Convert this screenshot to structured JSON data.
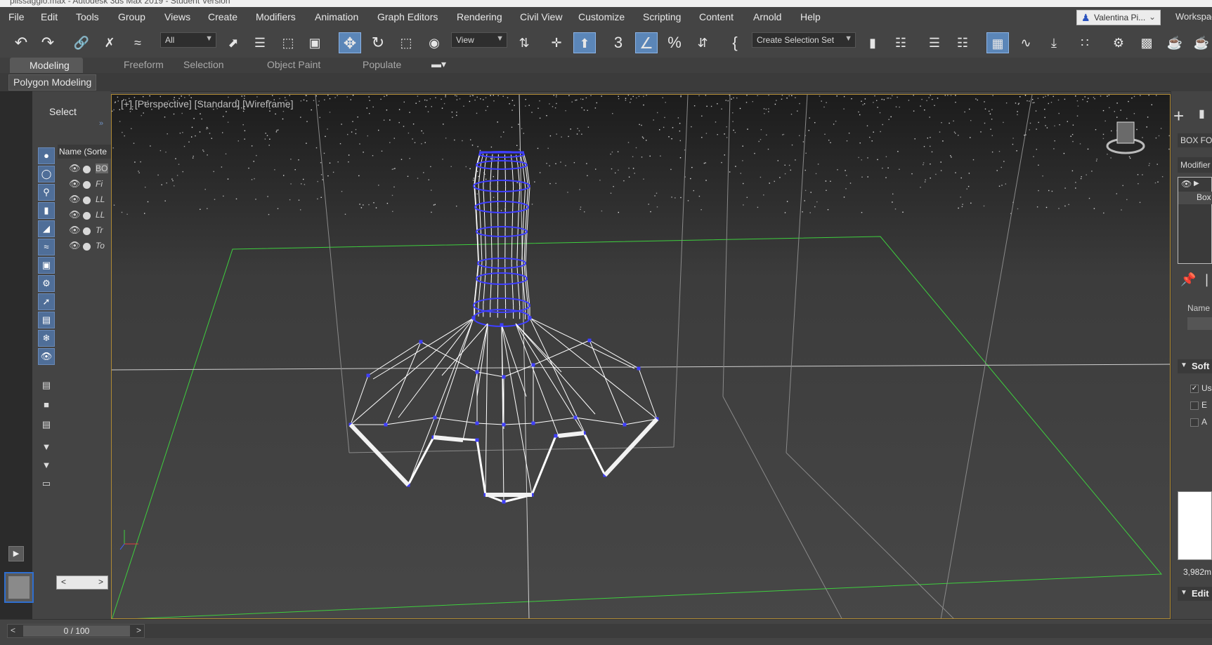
{
  "app": {
    "title": "plissaggio.max - Autodesk 3ds Max 2019 - Student Version"
  },
  "menu": {
    "items": [
      "File",
      "Edit",
      "Tools",
      "Group",
      "Views",
      "Create",
      "Modifiers",
      "Animation",
      "Graph Editors",
      "Rendering",
      "Civil View",
      "Customize",
      "Scripting",
      "Content",
      "Arnold",
      "Help"
    ],
    "user": "Valentina Pi...",
    "workspaces": "Workspac"
  },
  "toolbar": {
    "selection_filter": "All",
    "ref_coord": "View",
    "named_selection": "Create Selection Set",
    "icons": {
      "undo": "undo-icon",
      "redo": "redo-icon",
      "link": "link-icon",
      "unlink": "unlink-icon",
      "bind": "bind-spacewarp-icon",
      "select": "select-object-icon",
      "select_by_name": "select-by-name-icon",
      "rect_region": "rectangular-region-icon",
      "window_crossing": "window-crossing-icon",
      "move": "move-icon",
      "rotate": "rotate-icon",
      "scale": "scale-icon",
      "place": "place-icon",
      "pivot": "use-pivot-icon",
      "mirror_axis": "axis-constraint-icon",
      "keyboard_shortcut": "keyboard-override-icon",
      "snaps": "snaps-toggle-icon",
      "angle_snap": "angle-snap-icon",
      "percent_snap": "percent-snap-icon",
      "spinner_snap": "spinner-snap-icon",
      "edit_named": "edit-named-selection-icon",
      "mirror": "mirror-icon",
      "align": "align-icon",
      "scene_explorer": "scene-explorer-icon",
      "layer_explorer": "layer-explorer-icon",
      "ribbon": "ribbon-toggle-icon",
      "curve_editor": "curve-editor-icon",
      "dope_sheet": "dope-sheet-icon",
      "schematic": "schematic-view-icon",
      "render_setup": "render-setup-icon",
      "render_frame": "rendered-frame-icon",
      "render": "render-icon",
      "render2": "render-production-icon"
    }
  },
  "ribbon": {
    "tabs": [
      "Modeling",
      "Freeform",
      "Selection",
      "Object Paint",
      "Populate"
    ],
    "active_tab": "Modeling",
    "panel": "Polygon Modeling"
  },
  "explorer": {
    "title": "Select",
    "column": "Name (Sorte",
    "rows": [
      {
        "name": "BO",
        "selected": true
      },
      {
        "name": "Fi",
        "selected": false
      },
      {
        "name": "LL",
        "selected": false
      },
      {
        "name": "LL",
        "selected": false
      },
      {
        "name": "Tr",
        "selected": false
      },
      {
        "name": "To",
        "selected": false
      }
    ],
    "tools": [
      "display-geometry-icon",
      "display-shapes-icon",
      "display-lights-icon",
      "display-cameras-icon",
      "display-helpers-icon",
      "display-spacewarps-icon",
      "display-groups-icon",
      "display-xrefs-icon",
      "display-bones-icon",
      "display-containers-icon",
      "display-frozen-icon",
      "display-hidden-icon"
    ]
  },
  "viewport": {
    "label": "[+] [Perspective] [Standard] [Wireframe]",
    "colors": {
      "background": "#434343",
      "grid": "#3ecf3e",
      "wire": "#ffffff",
      "vertex": "#3f3fff"
    }
  },
  "command_panel": {
    "object_name": "BOX FO",
    "modifier_list": "Modifier",
    "stack_item": "Box",
    "name_label": "Name",
    "soft_selection": "Soft",
    "checkbox_1": {
      "label": "Us",
      "checked": true
    },
    "checkbox_2": {
      "label": "E",
      "checked": false
    },
    "checkbox_3": {
      "label": "A",
      "checked": false
    },
    "curve_value": "3,982m",
    "edit_rollout": "Edit"
  },
  "timeline": {
    "frame": "0 / 100"
  }
}
